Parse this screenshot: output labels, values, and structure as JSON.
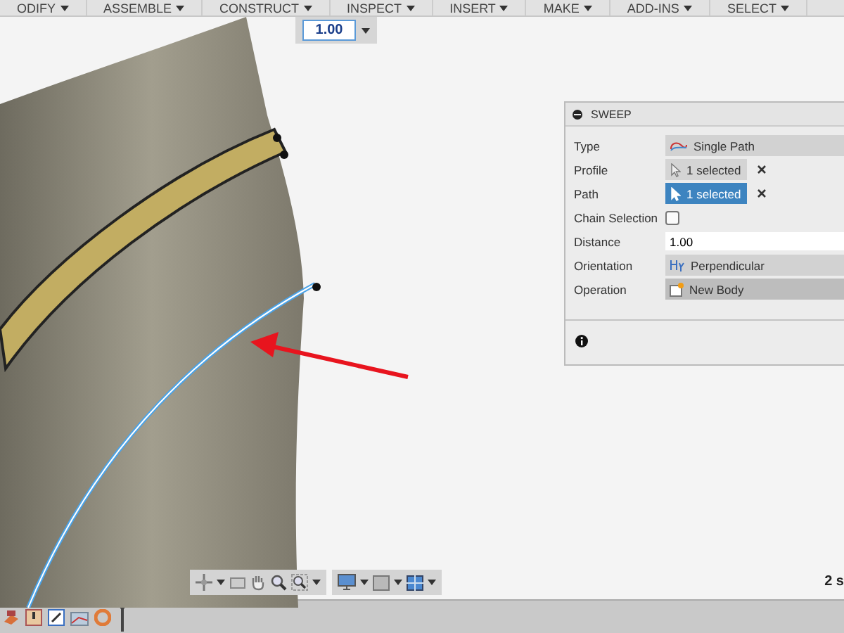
{
  "menu": [
    "ODIFY",
    "ASSEMBLE",
    "CONSTRUCT",
    "INSPECT",
    "INSERT",
    "MAKE",
    "ADD-INS",
    "SELECT"
  ],
  "value_box": {
    "value": "1.00"
  },
  "sweep": {
    "title": "SWEEP",
    "rows": [
      {
        "kind": "select",
        "label": "Type",
        "value": "Single Path"
      },
      {
        "kind": "selection",
        "label": "Profile",
        "value": "1 selected",
        "selected": false
      },
      {
        "kind": "selection",
        "label": "Path",
        "value": "1 selected",
        "selected": true
      },
      {
        "kind": "checkbox",
        "label": "Chain Selection",
        "checked": false
      },
      {
        "kind": "input",
        "label": "Distance",
        "value": "1.00"
      },
      {
        "kind": "select",
        "label": "Orientation",
        "value": "Perpendicular"
      },
      {
        "kind": "select",
        "label": "Operation",
        "value": "New Body"
      }
    ]
  },
  "status": {
    "text": "2 s"
  }
}
